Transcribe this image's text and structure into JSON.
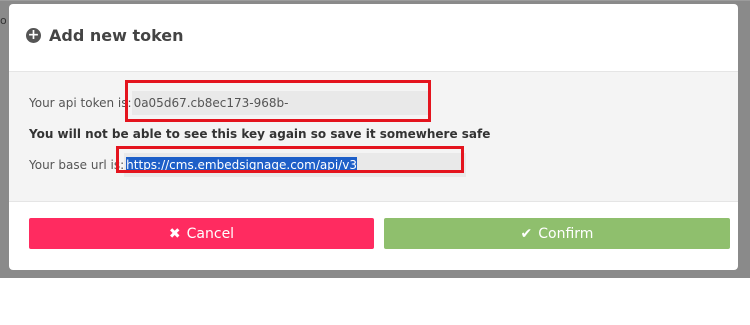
{
  "background": {
    "peek_text": "o"
  },
  "modal": {
    "title": "Add new token",
    "title_icon": "plus-circle-icon",
    "token_label": "Your api token is:",
    "token_value": "0a05d67.cb8ec173-968b-",
    "warning": "You will not be able to see this key again so save it somewhere safe",
    "url_label": "Your base url is:",
    "url_value": "https://cms.embedsignage.com/api/v3"
  },
  "buttons": {
    "cancel_icon": "✖",
    "cancel_label": "Cancel",
    "confirm_icon": "✔",
    "confirm_label": "Confirm"
  },
  "colors": {
    "cancel": "#ff2b60",
    "confirm": "#8fbf6d",
    "highlight": "#e4141e",
    "selection": "#1e5fc8"
  }
}
